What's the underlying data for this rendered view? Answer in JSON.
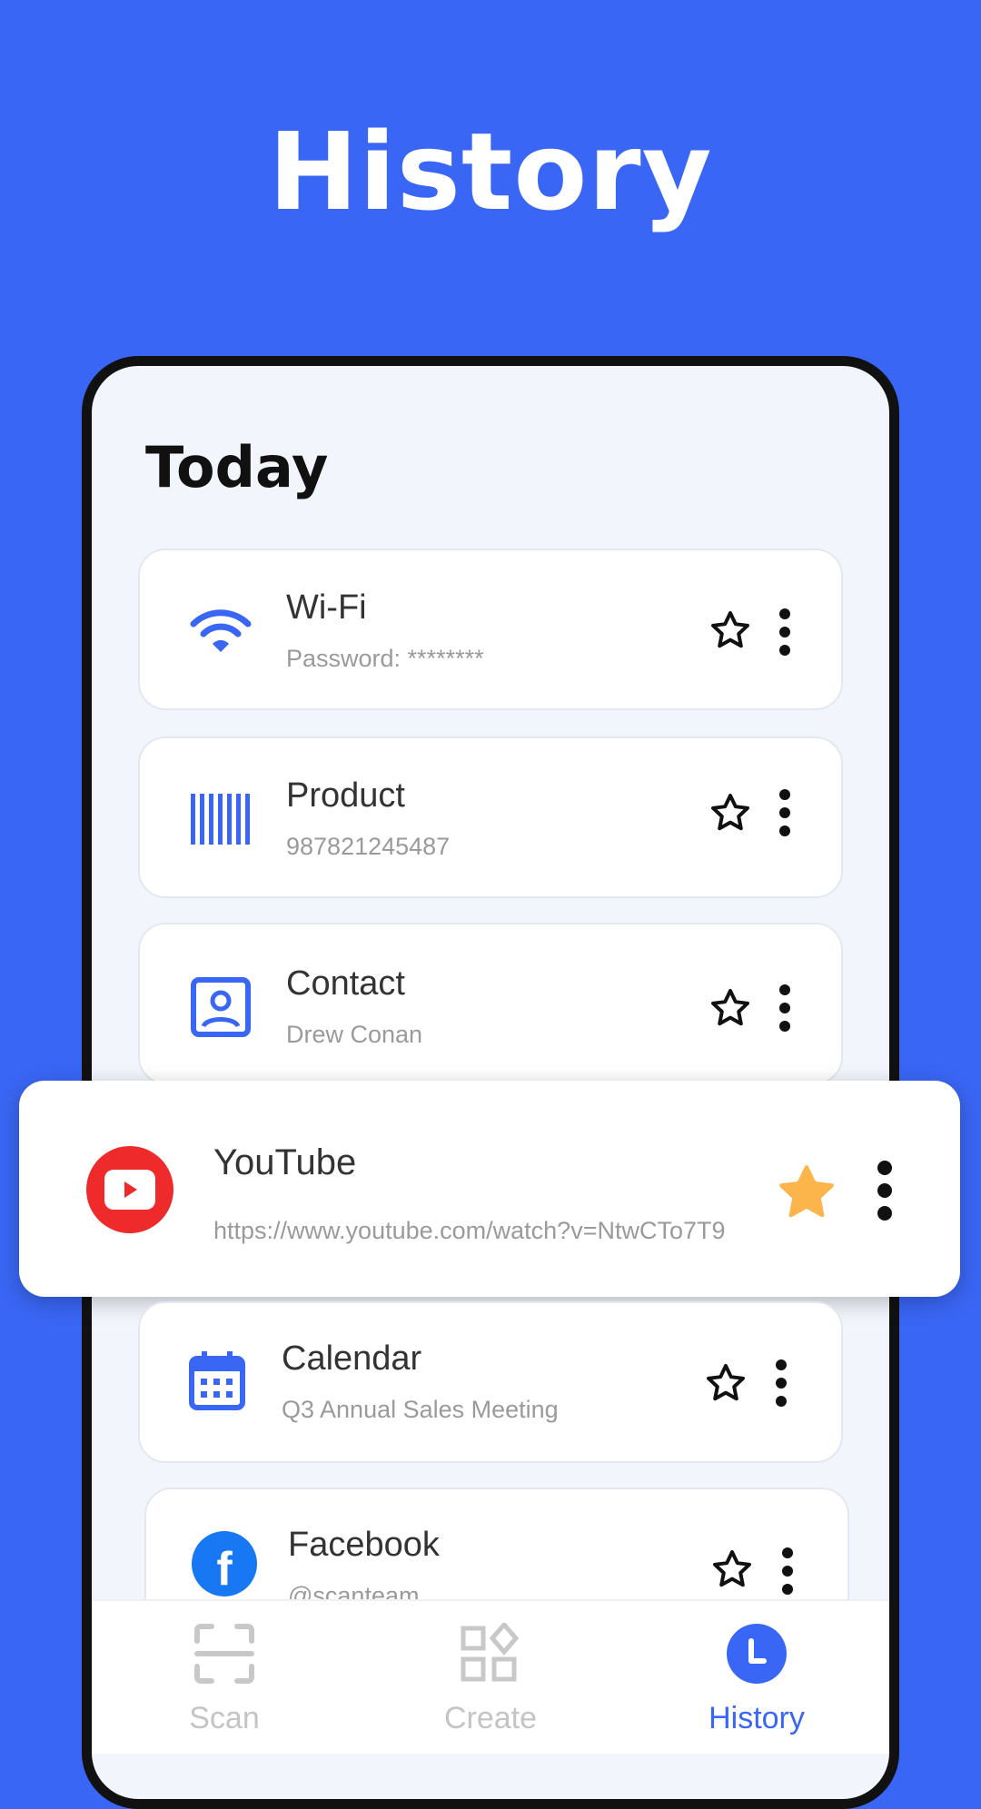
{
  "headline": "History",
  "section_title": "Today",
  "colors": {
    "background": "#3a66f5",
    "accent": "#3a66f5",
    "favorite": "#fbb54a",
    "youtube": "#ee2a2a",
    "facebook": "#1877f2"
  },
  "items": [
    {
      "icon": "wifi-icon",
      "title": "Wi-Fi",
      "subtitle": "Password: ********",
      "favorite": false
    },
    {
      "icon": "barcode-icon",
      "title": "Product",
      "subtitle": "987821245487",
      "favorite": false
    },
    {
      "icon": "contact-icon",
      "title": "Contact",
      "subtitle": "Drew Conan",
      "favorite": false
    },
    {
      "icon": "youtube-icon",
      "title": "YouTube",
      "subtitle": "https://www.youtube.com/watch?v=NtwCTo7T9",
      "favorite": true
    },
    {
      "icon": "calendar-icon",
      "title": "Calendar",
      "subtitle": "Q3 Annual Sales Meeting",
      "favorite": false
    },
    {
      "icon": "facebook-icon",
      "title": "Facebook",
      "subtitle": "@scanteam",
      "favorite": false
    }
  ],
  "nav": [
    {
      "label": "Scan",
      "icon": "scan-icon",
      "active": false
    },
    {
      "label": "Create",
      "icon": "create-icon",
      "active": false
    },
    {
      "label": "History",
      "icon": "history-icon",
      "active": true
    }
  ]
}
